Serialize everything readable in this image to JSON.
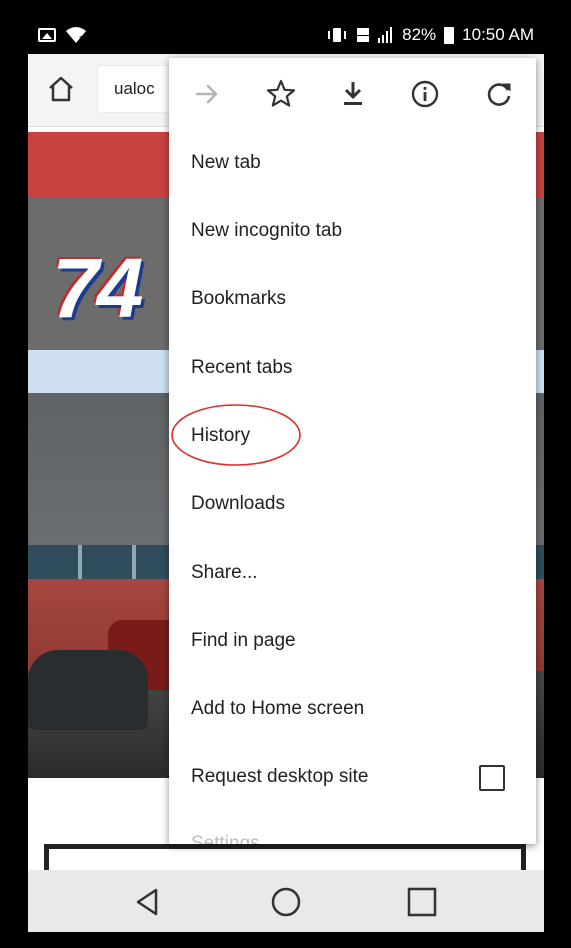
{
  "status_bar": {
    "battery_percent": "82%",
    "time": "10:50 AM",
    "icons": [
      "image-icon",
      "wifi-icon",
      "vibrate-icon",
      "lte-icon",
      "signal-icon",
      "battery-icon"
    ]
  },
  "toolbar": {
    "url_text": "ualoc"
  },
  "page": {
    "banner_number": "74"
  },
  "menu": {
    "icons": [
      "forward-icon",
      "star-icon",
      "download-icon",
      "info-icon",
      "refresh-icon"
    ],
    "items": [
      {
        "label": "New tab"
      },
      {
        "label": "New incognito tab"
      },
      {
        "label": "Bookmarks"
      },
      {
        "label": "Recent tabs"
      },
      {
        "label": "History"
      },
      {
        "label": "Downloads"
      },
      {
        "label": "Share..."
      },
      {
        "label": "Find in page"
      },
      {
        "label": "Add to Home screen"
      },
      {
        "label": "Request desktop site"
      }
    ],
    "peek_label": "Settings"
  },
  "colors": {
    "banner_red": "#c94242",
    "annotation_red": "#d9302a"
  },
  "nav_bar": {
    "buttons": [
      "back-icon",
      "home-circle-icon",
      "recents-icon"
    ]
  }
}
